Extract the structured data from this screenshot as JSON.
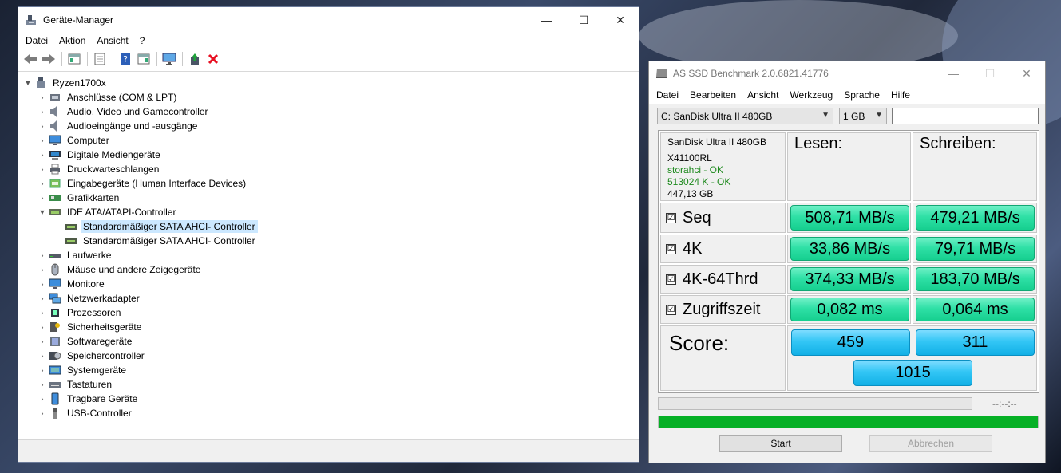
{
  "colors": {
    "tree_selection": "#cce8ff",
    "result_green": "#2fe0a6",
    "score_blue": "#33c6f5",
    "progress_green": "#06b025",
    "delete_red": "#e81123"
  },
  "devmgr": {
    "title": "Geräte-Manager",
    "window_controls": {
      "minimize": "—",
      "maximize": "☐",
      "close": "✕"
    },
    "menu": [
      "Datei",
      "Aktion",
      "Ansicht",
      "?"
    ],
    "toolbar": [
      "back-arrow-icon",
      "forward-arrow-icon",
      "properties-icon",
      "details-icon",
      "help-icon",
      "view-icon",
      "monitor-icon",
      "update-driver-icon",
      "delete-x-icon"
    ],
    "tree": {
      "root": "Ryzen1700x",
      "categories": [
        {
          "label": "Anschlüsse (COM & LPT)",
          "icon": "port-icon"
        },
        {
          "label": "Audio, Video und Gamecontroller",
          "icon": "speaker-icon"
        },
        {
          "label": "Audioeingänge und -ausgänge",
          "icon": "speaker-icon"
        },
        {
          "label": "Computer",
          "icon": "computer-icon"
        },
        {
          "label": "Digitale Mediengeräte",
          "icon": "media-device-icon"
        },
        {
          "label": "Druckwarteschlangen",
          "icon": "printer-icon"
        },
        {
          "label": "Eingabegeräte (Human Interface Devices)",
          "icon": "hid-icon"
        },
        {
          "label": "Grafikkarten",
          "icon": "display-adapter-icon"
        },
        {
          "label": "IDE ATA/ATAPI-Controller",
          "icon": "ide-controller-icon",
          "expanded": true,
          "children": [
            {
              "label": "Standardmäßiger SATA AHCI- Controller",
              "selected": true
            },
            {
              "label": "Standardmäßiger SATA AHCI- Controller"
            }
          ]
        },
        {
          "label": "Laufwerke",
          "icon": "disk-drive-icon"
        },
        {
          "label": "Mäuse und andere Zeigegeräte",
          "icon": "mouse-icon"
        },
        {
          "label": "Monitore",
          "icon": "monitor-icon"
        },
        {
          "label": "Netzwerkadapter",
          "icon": "network-adapter-icon"
        },
        {
          "label": "Prozessoren",
          "icon": "processor-icon"
        },
        {
          "label": "Sicherheitsgeräte",
          "icon": "security-key-icon"
        },
        {
          "label": "Softwaregeräte",
          "icon": "software-device-icon"
        },
        {
          "label": "Speichercontroller",
          "icon": "storage-controller-icon"
        },
        {
          "label": "Systemgeräte",
          "icon": "system-device-icon"
        },
        {
          "label": "Tastaturen",
          "icon": "keyboard-icon"
        },
        {
          "label": "Tragbare Geräte",
          "icon": "portable-device-icon"
        },
        {
          "label": "USB-Controller",
          "icon": "usb-icon"
        }
      ]
    }
  },
  "asssd": {
    "title": "AS SSD Benchmark 2.0.6821.41776",
    "window_controls": {
      "minimize": "—",
      "maximize": "☐",
      "close": "✕"
    },
    "menu": [
      "Datei",
      "Bearbeiten",
      "Ansicht",
      "Werkzeug",
      "Sprache",
      "Hilfe"
    ],
    "drive_select": "C: SanDisk Ultra II 480GB",
    "size_select": "1 GB",
    "drive_info": {
      "name": "SanDisk Ultra II 480GB",
      "firmware": "X41100RL",
      "driver": "storahci - OK",
      "alignment": "513024 K - OK",
      "capacity": "447,13 GB"
    },
    "headers": {
      "read": "Lesen:",
      "write": "Schreiben:"
    },
    "rows": [
      {
        "label": "Seq",
        "check": "☑",
        "read": "508,71 MB/s",
        "write": "479,21 MB/s"
      },
      {
        "label": "4K",
        "check": "☑",
        "read": "33,86 MB/s",
        "write": "79,71 MB/s"
      },
      {
        "label": "4K-64Thrd",
        "check": "☑",
        "read": "374,33 MB/s",
        "write": "183,70 MB/s"
      },
      {
        "label": "Zugriffszeit",
        "check": "☑",
        "read": "0,082 ms",
        "write": "0,064 ms"
      }
    ],
    "score": {
      "label": "Score:",
      "read": "459",
      "write": "311",
      "total": "1015"
    },
    "timer": "--:--:--",
    "progress_fraction": 1.0,
    "buttons": {
      "start": "Start",
      "abort": "Abbrechen"
    }
  }
}
